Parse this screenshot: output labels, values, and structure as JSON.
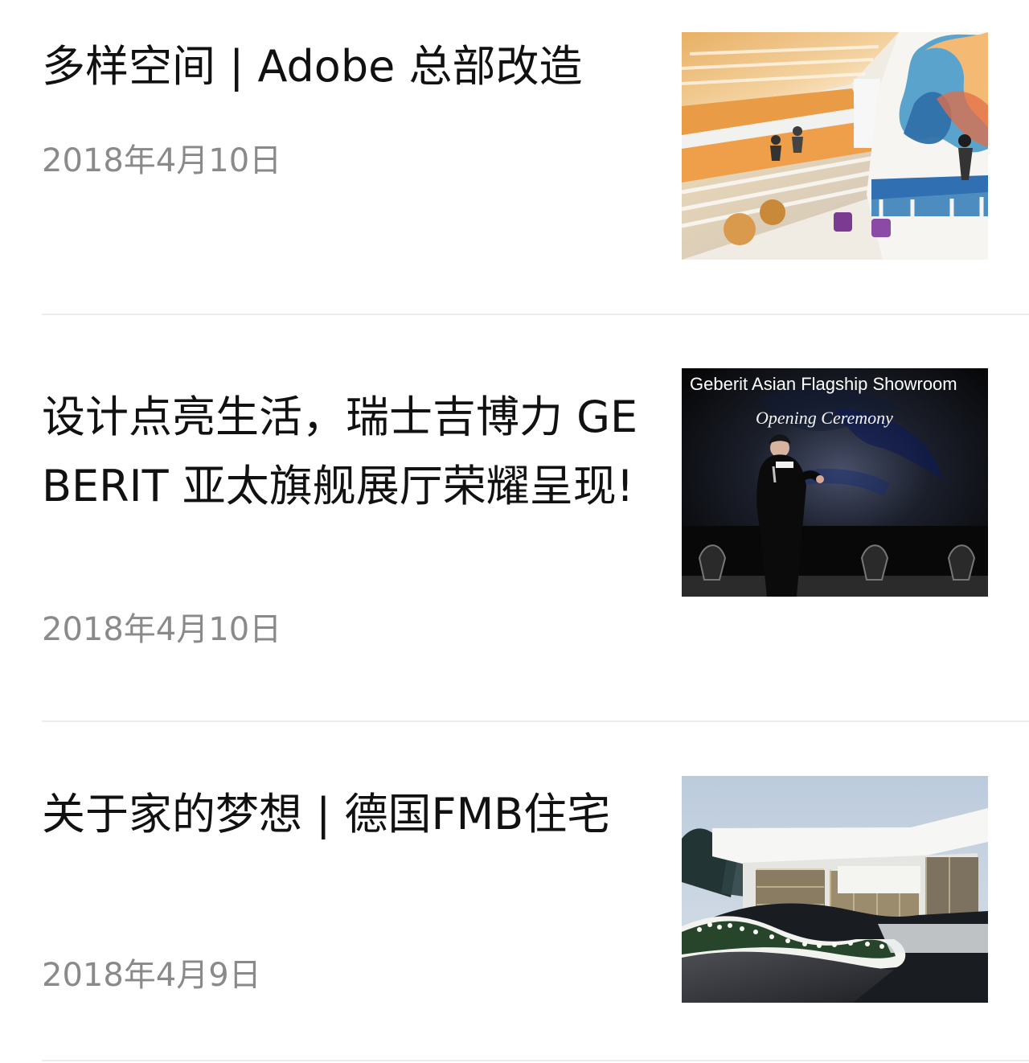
{
  "articles": [
    {
      "title": "多样空间 | Adobe 总部改造",
      "date": "2018年4月10日",
      "thumbnail": {
        "icon": "office-atrium-photo"
      }
    },
    {
      "title": "设计点亮生活，瑞士吉博力 GEBERIT 亚太旗舰展厅荣耀呈现!",
      "date": "2018年4月10日",
      "thumbnail": {
        "icon": "presenter-stage-photo",
        "caption": "Geberit Asian Flagship Showroom",
        "subcaption": "Opening Ceremony"
      }
    },
    {
      "title": "关于家的梦想 | 德国FMB住宅",
      "date": "2018年4月9日",
      "thumbnail": {
        "icon": "modern-house-photo"
      }
    }
  ],
  "colors": {
    "title": "#111111",
    "date": "#8a8a8a",
    "divider": "#ececec"
  }
}
